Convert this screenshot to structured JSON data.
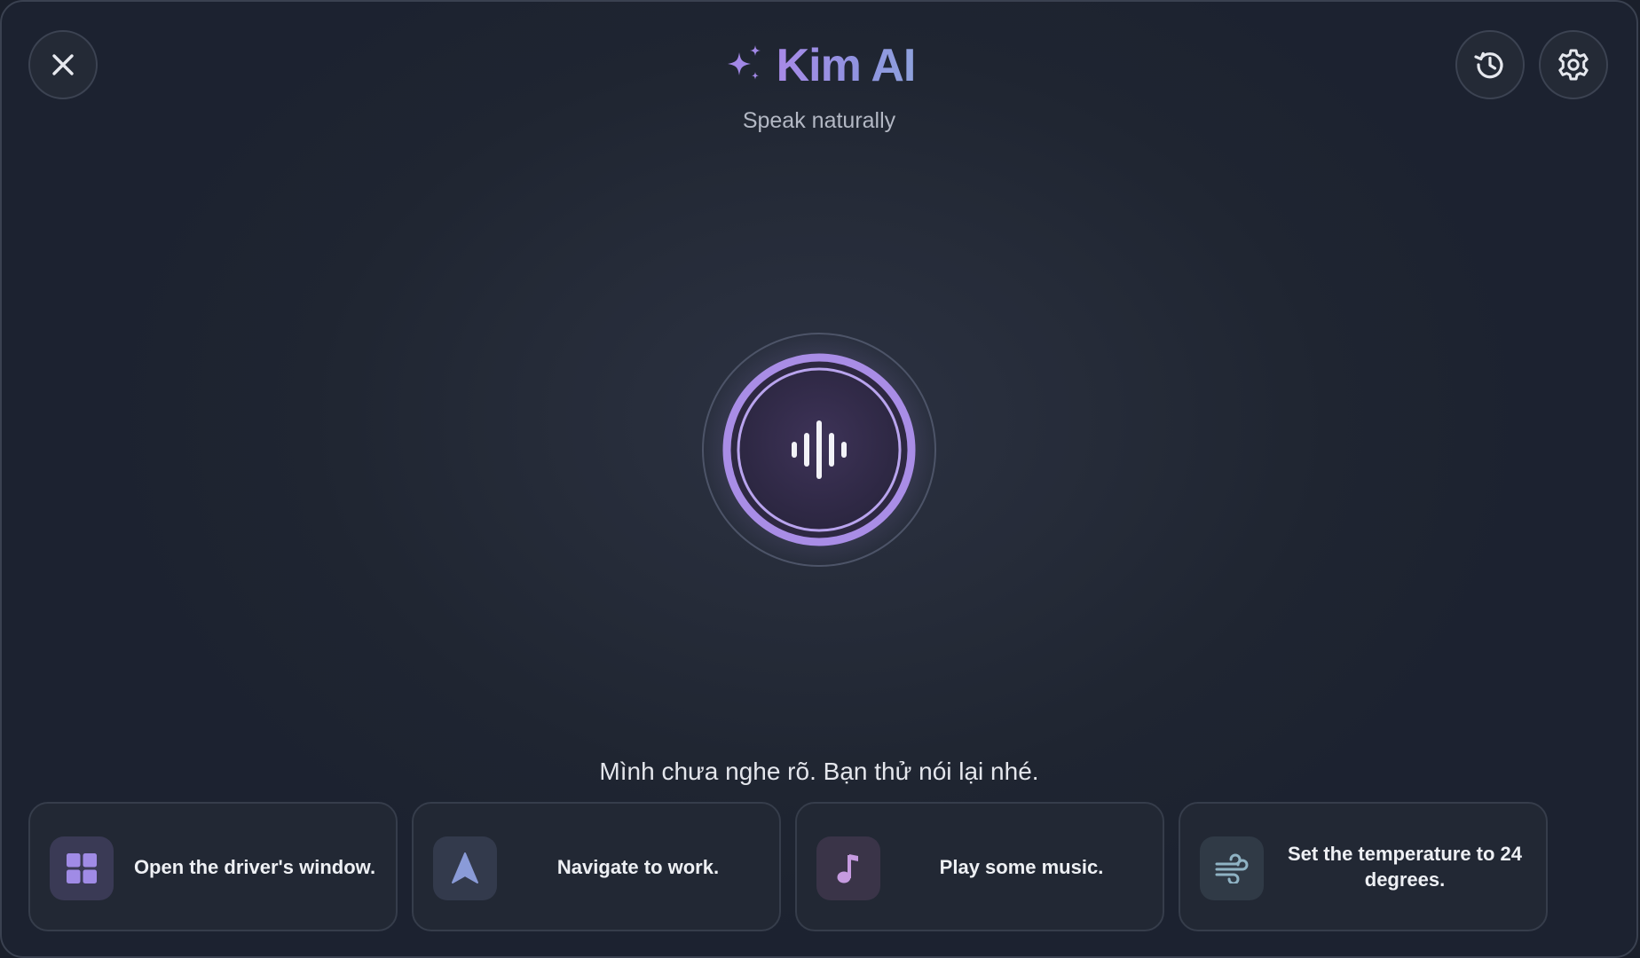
{
  "header": {
    "title": "Kim AI",
    "subtitle": "Speak naturally",
    "close_icon": "close-icon",
    "history_icon": "history-icon",
    "settings_icon": "gear-icon"
  },
  "assistant": {
    "state_icon": "waveform-icon",
    "status_message": "Mình chưa nghe rõ. Bạn thử nói lại nhé."
  },
  "suggestions": [
    {
      "label": "Open the driver's window.",
      "icon": "window-grid-icon",
      "icon_color": "#a08be6",
      "icon_bg": "#3a3a55"
    },
    {
      "label": "Navigate to work.",
      "icon": "navigation-arrow-icon",
      "icon_color": "#8a9bd8",
      "icon_bg": "#333a4c"
    },
    {
      "label": "Play some music.",
      "icon": "music-note-icon",
      "icon_color": "#c69be0",
      "icon_bg": "#3a3448"
    },
    {
      "label": "Set the temperature to 24 degrees.",
      "icon": "fan-wind-icon",
      "icon_color": "#8fb3c4",
      "icon_bg": "#303a46"
    }
  ],
  "colors": {
    "accent": "#a88ae8",
    "ring": "#a98de6",
    "background": "#1f2531"
  }
}
